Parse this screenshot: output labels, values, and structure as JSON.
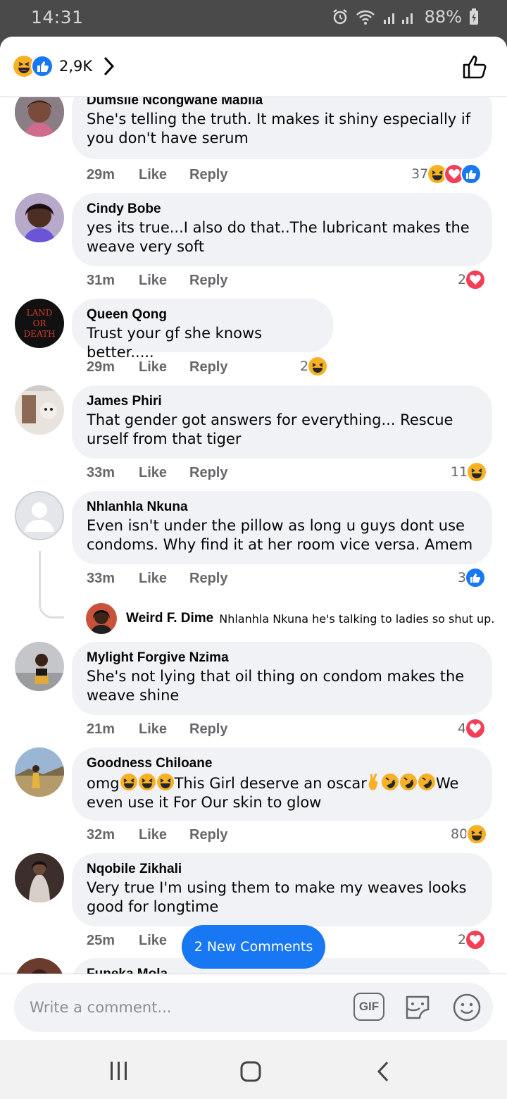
{
  "status_bar": {
    "time": "14:31",
    "battery": "88%"
  },
  "header": {
    "reaction_count": "2,9K",
    "reaction_icons": [
      "haha",
      "like"
    ]
  },
  "comments": [
    {
      "author": "Dumsile Ncongwane Mabila",
      "text": "She's telling the truth. It makes it shiny especially if you don't have serum",
      "time": "29m",
      "like_label": "Like",
      "reply_label": "Reply",
      "reaction_count": "37",
      "reactions": [
        "haha",
        "love",
        "like"
      ]
    },
    {
      "author": "Cindy Bobe",
      "text": "yes its true...I also do that..The lubricant makes the weave very soft",
      "time": "31m",
      "like_label": "Like",
      "reply_label": "Reply",
      "reaction_count": "2",
      "reactions": [
        "love"
      ]
    },
    {
      "author": "Queen Qong",
      "text": "Trust your gf she knows better.....",
      "time": "29m",
      "like_label": "Like",
      "reply_label": "Reply",
      "reaction_count": "2",
      "reactions": [
        "haha"
      ],
      "avatar_text": [
        "LAND",
        "OR",
        "DEATH"
      ]
    },
    {
      "author": "James Phiri",
      "text": "That gender got answers for everything... Rescue urself from that tiger",
      "time": "33m",
      "like_label": "Like",
      "reply_label": "Reply",
      "reaction_count": "11",
      "reactions": [
        "haha"
      ]
    },
    {
      "author": "Nhlanhla Nkuna",
      "text": "Even isn't under the pillow as long u guys dont use condoms. Why find it at her room vice versa. Amem",
      "time": "33m",
      "like_label": "Like",
      "reply_label": "Reply",
      "reaction_count": "3",
      "reactions": [
        "like"
      ]
    },
    {
      "author": "Mylight Forgive Nzima",
      "text": "She's not lying that oil thing on condom makes the weave shine",
      "time": "21m",
      "like_label": "Like",
      "reply_label": "Reply",
      "reaction_count": "4",
      "reactions": [
        "love"
      ]
    },
    {
      "author": "Goodness Chiloane",
      "text_a": "omg",
      "text_b": "This Girl deserve an oscar",
      "text_c": "We even use it For Our skin to glow",
      "time": "32m",
      "like_label": "Like",
      "reply_label": "Reply",
      "reaction_count": "80",
      "reactions": [
        "haha"
      ]
    },
    {
      "author": "Nqobile Zikhali",
      "text": "Very true I'm using them to make my weaves looks good for longtime",
      "time": "25m",
      "like_label": "Like",
      "reaction_count": "2",
      "reactions": [
        "love"
      ]
    },
    {
      "author": "Funeka Mola"
    }
  ],
  "reply": {
    "author": "Weird F. Dime",
    "text": "Nhlanhla Nkuna he's talking to ladies so shut up..."
  },
  "new_comments_label": "2 New Comments",
  "composer": {
    "placeholder": "Write a comment...",
    "gif_label": "GIF"
  },
  "colors": {
    "accent": "#1877f2",
    "love": "#f33e58",
    "haha": "#f7b125",
    "bubble": "#f0f2f5"
  }
}
